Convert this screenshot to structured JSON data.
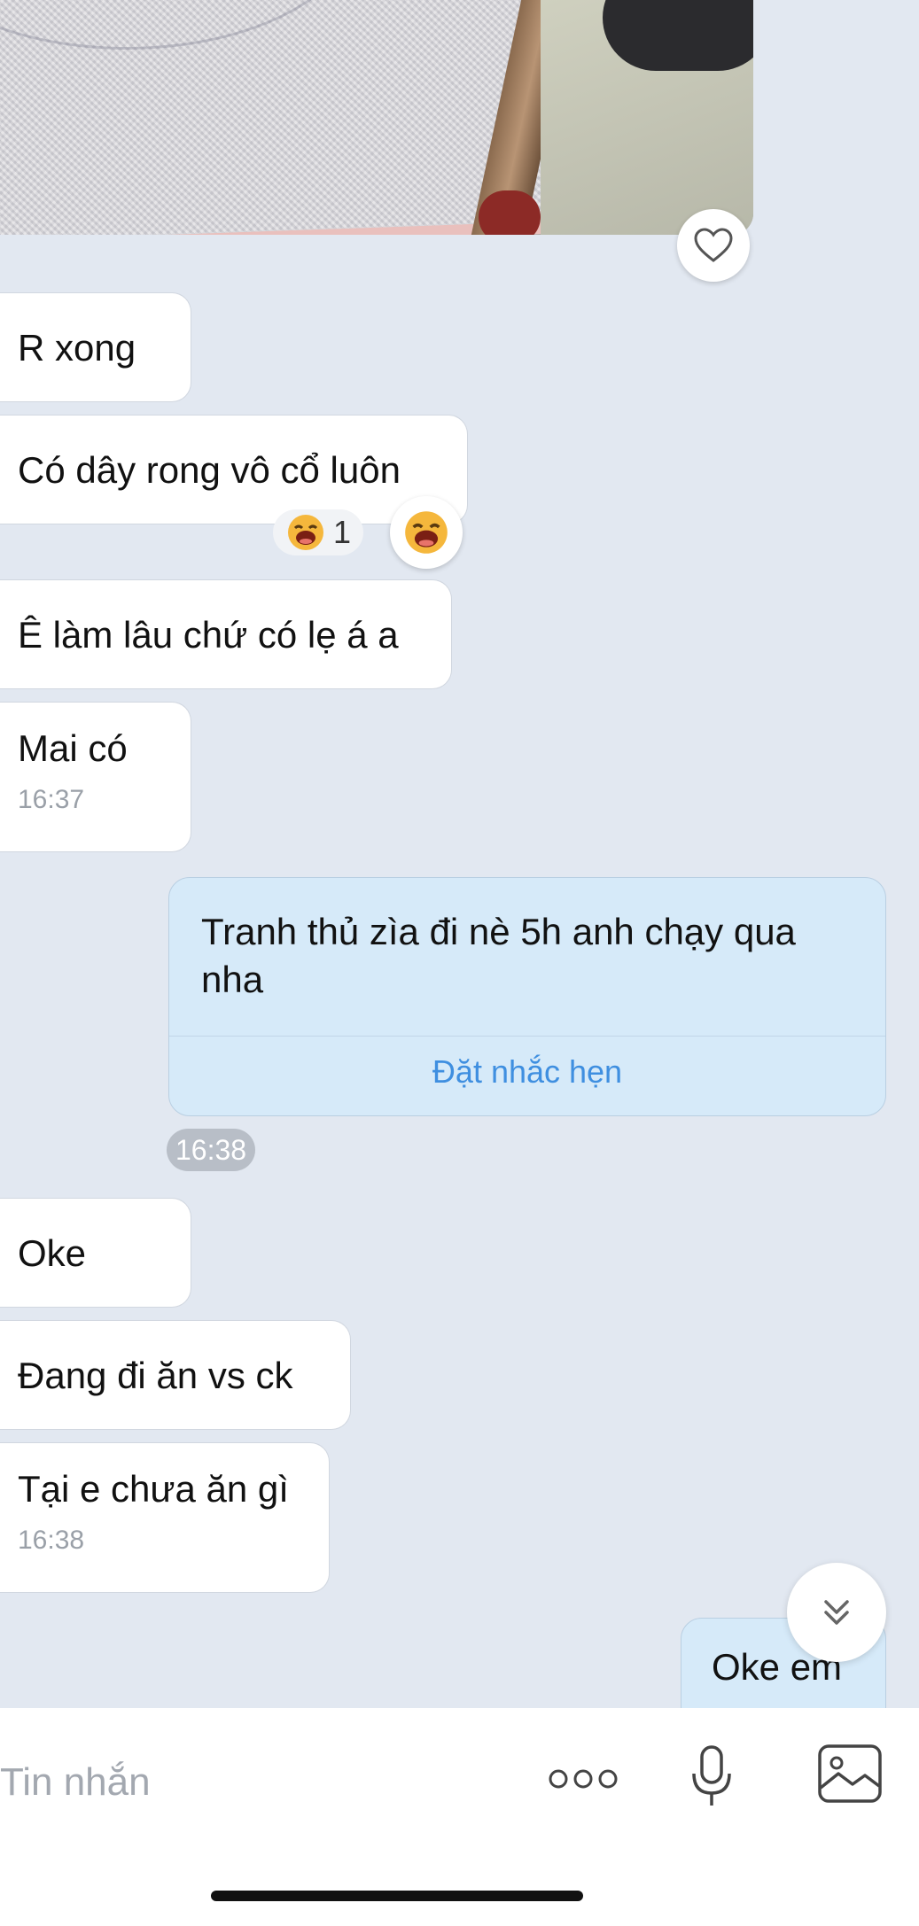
{
  "messages_incoming": [
    {
      "text": "R xong"
    },
    {
      "text": "Có dây rong vô cổ luôn"
    },
    {
      "text": "Ê làm lâu chứ có lẹ á a"
    },
    {
      "text": "Mai có",
      "time": "16:37"
    },
    {
      "text": "Oke"
    },
    {
      "text": "Đang đi ăn vs ck"
    },
    {
      "text": "Tại e chưa ăn gì",
      "time": "16:38"
    }
  ],
  "outgoing_reminder": {
    "text": "Tranh thủ zìa đi nè 5h anh chạy qua nha",
    "action": "Đặt nhắc hẹn",
    "time": "16:38"
  },
  "outgoing_last": {
    "text": "Oke em"
  },
  "reaction": {
    "emoji": "laughing-face",
    "count": "1"
  },
  "composer": {
    "placeholder": "Tin nhắn"
  },
  "colors": {
    "background": "#e2e8f1",
    "my_bubble": "#d6eaf9",
    "accent": "#3f8fe0"
  }
}
